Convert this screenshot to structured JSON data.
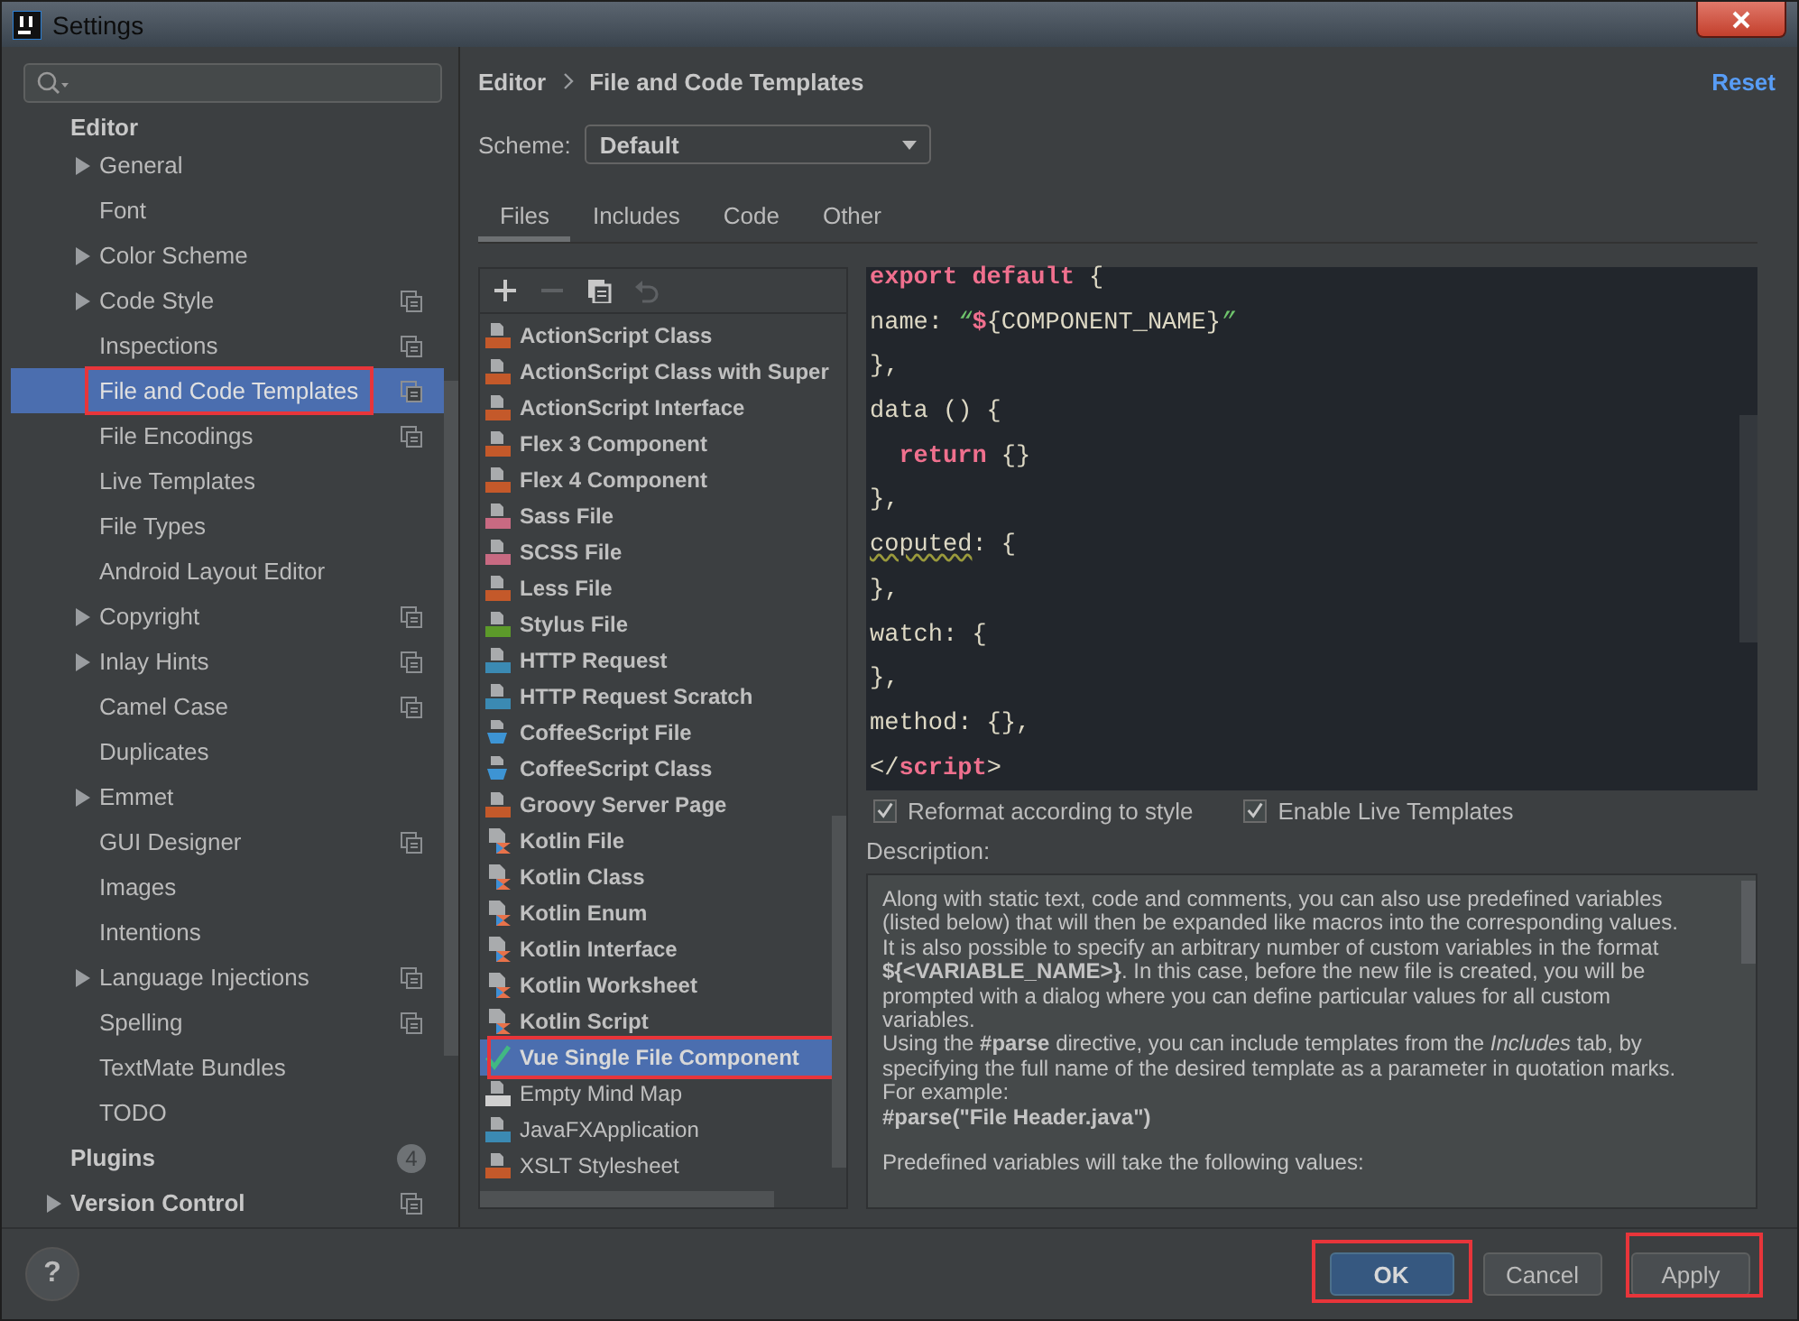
{
  "window": {
    "title": "Settings"
  },
  "sidebar": {
    "sections": [
      {
        "title": "Editor",
        "expandable": false,
        "project_level": false,
        "items": [
          {
            "label": "General",
            "expandable": true,
            "project_level": false,
            "selected": false,
            "highlighted": false
          },
          {
            "label": "Font",
            "expandable": false,
            "project_level": false,
            "selected": false,
            "highlighted": false
          },
          {
            "label": "Color Scheme",
            "expandable": true,
            "project_level": false,
            "selected": false,
            "highlighted": false
          },
          {
            "label": "Code Style",
            "expandable": true,
            "project_level": true,
            "selected": false,
            "highlighted": false
          },
          {
            "label": "Inspections",
            "expandable": false,
            "project_level": true,
            "selected": false,
            "highlighted": false
          },
          {
            "label": "File and Code Templates",
            "expandable": false,
            "project_level": true,
            "selected": true,
            "highlighted": true
          },
          {
            "label": "File Encodings",
            "expandable": false,
            "project_level": true,
            "selected": false,
            "highlighted": false
          },
          {
            "label": "Live Templates",
            "expandable": false,
            "project_level": false,
            "selected": false,
            "highlighted": false
          },
          {
            "label": "File Types",
            "expandable": false,
            "project_level": false,
            "selected": false,
            "highlighted": false
          },
          {
            "label": "Android Layout Editor",
            "expandable": false,
            "project_level": false,
            "selected": false,
            "highlighted": false
          },
          {
            "label": "Copyright",
            "expandable": true,
            "project_level": true,
            "selected": false,
            "highlighted": false
          },
          {
            "label": "Inlay Hints",
            "expandable": true,
            "project_level": true,
            "selected": false,
            "highlighted": false
          },
          {
            "label": "Camel Case",
            "expandable": false,
            "project_level": true,
            "selected": false,
            "highlighted": false
          },
          {
            "label": "Duplicates",
            "expandable": false,
            "project_level": false,
            "selected": false,
            "highlighted": false
          },
          {
            "label": "Emmet",
            "expandable": true,
            "project_level": false,
            "selected": false,
            "highlighted": false
          },
          {
            "label": "GUI Designer",
            "expandable": false,
            "project_level": true,
            "selected": false,
            "highlighted": false
          },
          {
            "label": "Images",
            "expandable": false,
            "project_level": false,
            "selected": false,
            "highlighted": false
          },
          {
            "label": "Intentions",
            "expandable": false,
            "project_level": false,
            "selected": false,
            "highlighted": false
          },
          {
            "label": "Language Injections",
            "expandable": true,
            "project_level": true,
            "selected": false,
            "highlighted": false
          },
          {
            "label": "Spelling",
            "expandable": false,
            "project_level": true,
            "selected": false,
            "highlighted": false
          },
          {
            "label": "TextMate Bundles",
            "expandable": false,
            "project_level": false,
            "selected": false,
            "highlighted": false
          },
          {
            "label": "TODO",
            "expandable": false,
            "project_level": false,
            "selected": false,
            "highlighted": false
          }
        ]
      },
      {
        "title": "Plugins",
        "expandable": false,
        "project_level": false,
        "badge": "4"
      },
      {
        "title": "Version Control",
        "expandable": true,
        "project_level": true
      }
    ]
  },
  "content": {
    "breadcrumb": [
      "Editor",
      "File and Code Templates"
    ],
    "reset_link": "Reset",
    "scheme": {
      "label": "Scheme:",
      "value": "Default"
    },
    "tabs": [
      {
        "label": "Files",
        "selected": true
      },
      {
        "label": "Includes",
        "selected": false
      },
      {
        "label": "Code",
        "selected": false
      },
      {
        "label": "Other",
        "selected": false
      }
    ],
    "toolbar": [
      {
        "kind": "add",
        "disabled": false
      },
      {
        "kind": "remove",
        "disabled": true
      },
      {
        "kind": "copy",
        "disabled": false
      },
      {
        "kind": "reset",
        "disabled": true
      }
    ],
    "templates": [
      {
        "label": "ActionScript Class",
        "kind": "as",
        "bold": true,
        "selected": false,
        "highlighted": false
      },
      {
        "label": "ActionScript Class with Super",
        "kind": "as",
        "bold": true,
        "selected": false,
        "highlighted": false
      },
      {
        "label": "ActionScript Interface",
        "kind": "as",
        "bold": true,
        "selected": false,
        "highlighted": false
      },
      {
        "label": "Flex 3 Component",
        "kind": "flex",
        "bold": true,
        "selected": false,
        "highlighted": false
      },
      {
        "label": "Flex 4 Component",
        "kind": "flex",
        "bold": true,
        "selected": false,
        "highlighted": false
      },
      {
        "label": "Sass File",
        "kind": "sass",
        "bold": true,
        "selected": false,
        "highlighted": false
      },
      {
        "label": "SCSS File",
        "kind": "sass",
        "bold": true,
        "selected": false,
        "highlighted": false
      },
      {
        "label": "Less File",
        "kind": "less",
        "bold": true,
        "selected": false,
        "highlighted": false
      },
      {
        "label": "Stylus File",
        "kind": "stylus",
        "bold": true,
        "selected": false,
        "highlighted": false
      },
      {
        "label": "HTTP Request",
        "kind": "api",
        "bold": true,
        "selected": false,
        "highlighted": false
      },
      {
        "label": "HTTP Request Scratch",
        "kind": "api",
        "bold": true,
        "selected": false,
        "highlighted": false
      },
      {
        "label": "CoffeeScript File",
        "kind": "coffee",
        "bold": true,
        "selected": false,
        "highlighted": false
      },
      {
        "label": "CoffeeScript Class",
        "kind": "coffee",
        "bold": true,
        "selected": false,
        "highlighted": false
      },
      {
        "label": "Groovy Server Page",
        "kind": "gsp",
        "bold": true,
        "selected": false,
        "highlighted": false
      },
      {
        "label": "Kotlin File",
        "kind": "kotlin",
        "bold": true,
        "selected": false,
        "highlighted": false
      },
      {
        "label": "Kotlin Class",
        "kind": "kotlin",
        "bold": true,
        "selected": false,
        "highlighted": false
      },
      {
        "label": "Kotlin Enum",
        "kind": "kotlin",
        "bold": true,
        "selected": false,
        "highlighted": false
      },
      {
        "label": "Kotlin Interface",
        "kind": "kotlin",
        "bold": true,
        "selected": false,
        "highlighted": false
      },
      {
        "label": "Kotlin Worksheet",
        "kind": "kotlin",
        "bold": true,
        "selected": false,
        "highlighted": false
      },
      {
        "label": "Kotlin Script",
        "kind": "kotlin",
        "bold": true,
        "selected": false,
        "highlighted": false
      },
      {
        "label": "Vue Single File Component",
        "kind": "vue",
        "bold": true,
        "selected": true,
        "highlighted": true
      },
      {
        "label": "Empty Mind Map",
        "kind": "mindmap",
        "bold": false,
        "selected": false,
        "highlighted": false
      },
      {
        "label": "JavaFXApplication",
        "kind": "java",
        "bold": false,
        "selected": false,
        "highlighted": false
      },
      {
        "label": "XSLT Stylesheet",
        "kind": "xslt",
        "bold": false,
        "selected": false,
        "highlighted": false
      }
    ],
    "code": [
      [
        {
          "text": "export default",
          "kind": "keyword"
        },
        {
          "text": " {",
          "kind": "plain"
        }
      ],
      [
        {
          "text": "name: ",
          "kind": "plain"
        },
        {
          "text": "“",
          "kind": "string"
        },
        {
          "text": "$",
          "kind": "keyword"
        },
        {
          "text": "{COMPONENT_NAME}",
          "kind": "plain"
        },
        {
          "text": "”",
          "kind": "string"
        }
      ],
      [
        {
          "text": "},",
          "kind": "plain"
        }
      ],
      [
        {
          "text": "data () {",
          "kind": "plain"
        }
      ],
      [
        {
          "text": "  return",
          "kind": "keyword"
        },
        {
          "text": " {}",
          "kind": "plain"
        }
      ],
      [
        {
          "text": "},",
          "kind": "plain"
        }
      ],
      [
        {
          "text": "coputed",
          "kind": "typo"
        },
        {
          "text": ": {",
          "kind": "plain"
        }
      ],
      [
        {
          "text": "},",
          "kind": "plain"
        }
      ],
      [
        {
          "text": "watch: {",
          "kind": "plain"
        }
      ],
      [
        {
          "text": "},",
          "kind": "plain"
        }
      ],
      [
        {
          "text": "method: {},",
          "kind": "plain"
        }
      ],
      [
        {
          "text": "</",
          "kind": "plain"
        },
        {
          "text": "script",
          "kind": "keyword"
        },
        {
          "text": ">",
          "kind": "plain"
        }
      ]
    ],
    "options": [
      {
        "label": "Reformat according to style",
        "checked": true
      },
      {
        "label": "Enable Live Templates",
        "checked": true
      }
    ],
    "description": {
      "label": "Description:",
      "paragraphs": [
        {
          "kind": "text",
          "text": "Along with static text, code and comments, you can also use predefined variables (listed below) that will then be expanded like macros into the corresponding values."
        },
        {
          "kind": "text",
          "text": "It is also possible to specify an arbitrary number of custom variables in the format **${<VARIABLE_NAME>}**. In this case, before the new file is created, you will be prompted with a dialog where you can define particular values for all custom variables."
        },
        {
          "kind": "text",
          "text": "Using the **#parse** directive, you can include templates from the *Includes* tab, by specifying the full name of the desired template as a parameter in quotation marks. For example:"
        },
        {
          "kind": "example",
          "text": "#parse(\"File Header.java\")"
        },
        {
          "kind": "heading",
          "text": "Predefined variables will take the following values:"
        }
      ]
    }
  },
  "footer": {
    "help": "?",
    "buttons": [
      {
        "label": "OK",
        "kind": "primary",
        "highlighted": true
      },
      {
        "label": "Cancel",
        "kind": "secondary",
        "highlighted": false
      },
      {
        "label": "Apply",
        "kind": "secondary",
        "highlighted": true
      }
    ]
  }
}
